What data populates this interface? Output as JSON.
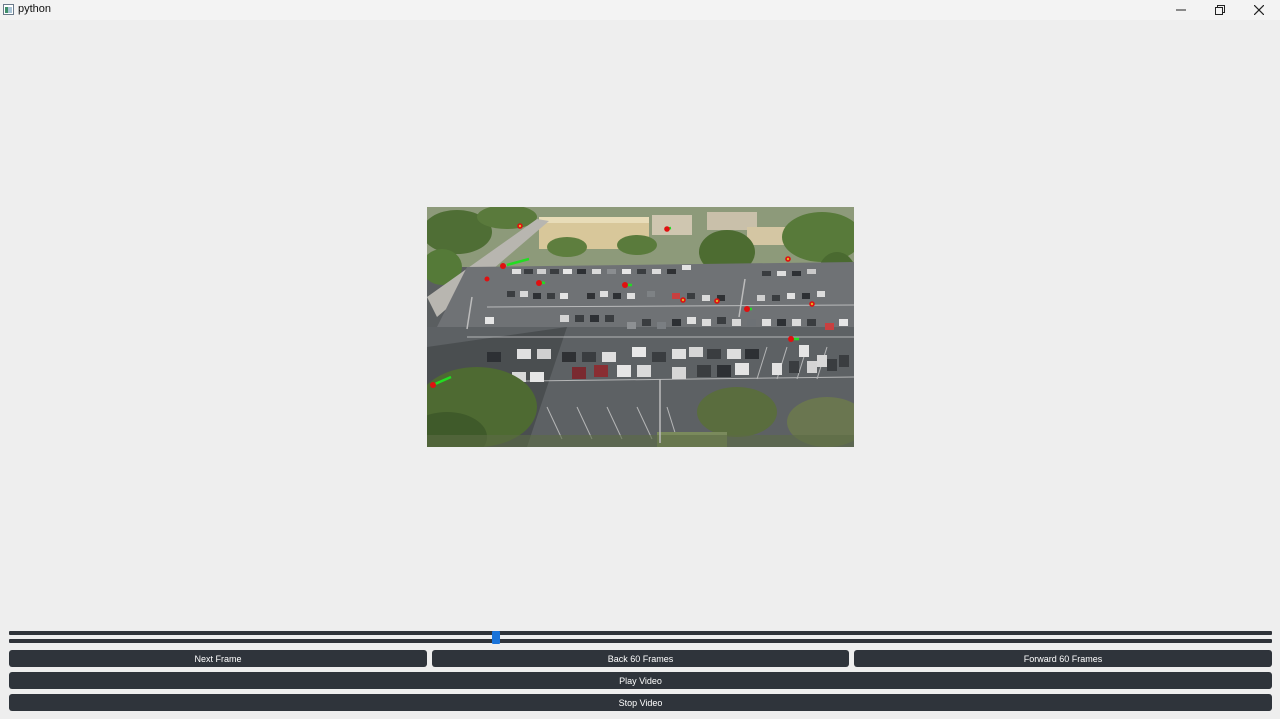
{
  "window": {
    "title": "python"
  },
  "controls": {
    "next_frame_label": "Next Frame",
    "back_60_label": "Back 60 Frames",
    "forward_60_label": "Forward 60 Frames",
    "play_label": "Play Video",
    "stop_label": "Stop Video"
  },
  "slider": {
    "position_fraction": 0.385
  },
  "colors": {
    "button_bg": "#2f343b",
    "slider_handle": "#1a73d9",
    "track_marker_head": "#e01010",
    "track_marker_tail": "#22dd22"
  }
}
